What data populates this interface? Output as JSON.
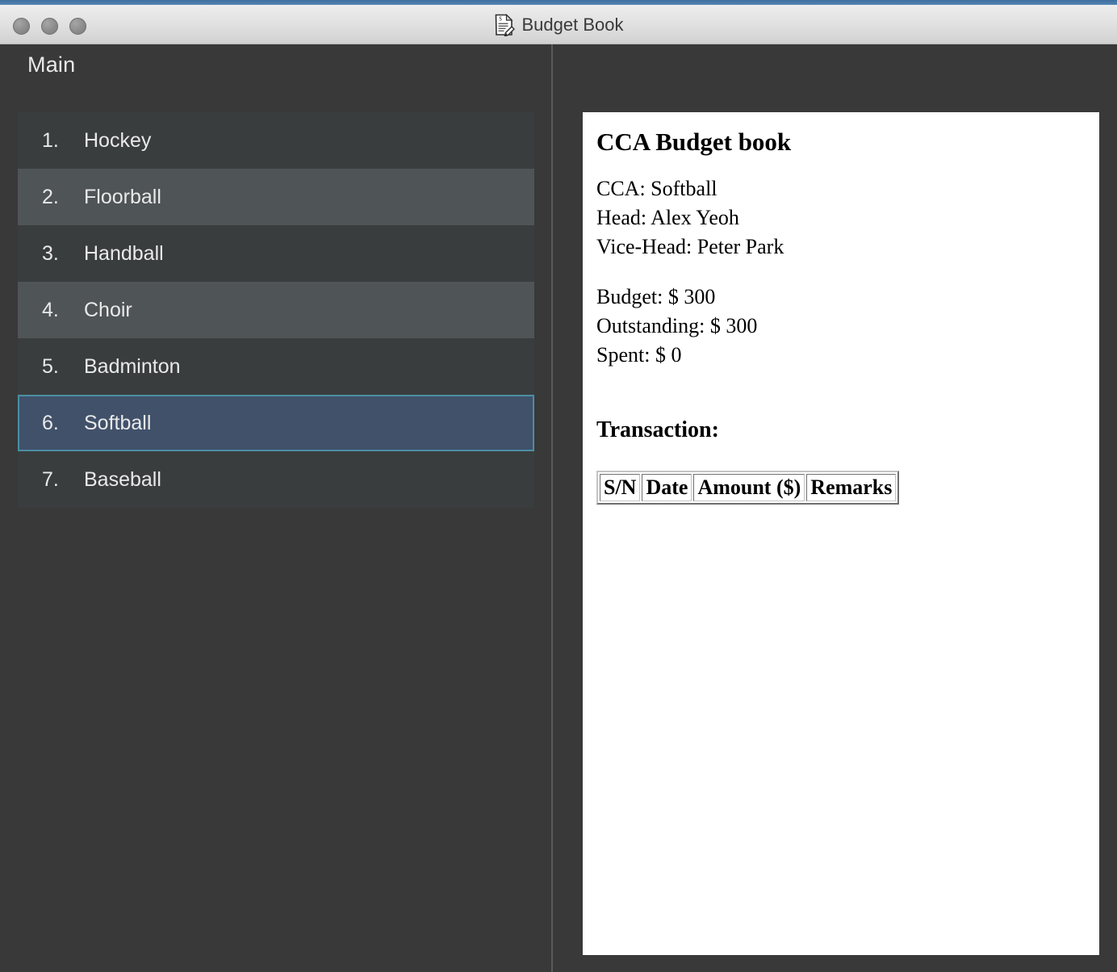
{
  "window": {
    "title": "Budget Book",
    "title_icon": "document-pencil-icon",
    "accent_color": "#5384b2",
    "traffic_lights": [
      "close-button",
      "minimize-button",
      "zoom-button"
    ]
  },
  "sidebar": {
    "header": "Main",
    "selected_index": 6,
    "selection_border_color": "#4a8fa3",
    "selection_fill_color": "#41516a",
    "items": [
      {
        "index": "1.",
        "label": "Hockey"
      },
      {
        "index": "2.",
        "label": "Floorball"
      },
      {
        "index": "3.",
        "label": "Handball"
      },
      {
        "index": "4.",
        "label": "Choir"
      },
      {
        "index": "5.",
        "label": "Badminton"
      },
      {
        "index": "6.",
        "label": "Softball"
      },
      {
        "index": "7.",
        "label": "Baseball"
      }
    ]
  },
  "document": {
    "heading": "CCA Budget book",
    "info": {
      "cca": "CCA: Softball",
      "head": "Head: Alex Yeoh",
      "vice_head": "Vice-Head: Peter Park"
    },
    "finance": {
      "budget": "Budget: $ 300",
      "outstanding": "Outstanding: $ 300",
      "spent": "Spent: $ 0"
    },
    "transaction_heading": "Transaction:",
    "transaction_table": {
      "columns": [
        "S/N",
        "Date",
        "Amount ($)",
        "Remarks"
      ],
      "rows": []
    }
  }
}
